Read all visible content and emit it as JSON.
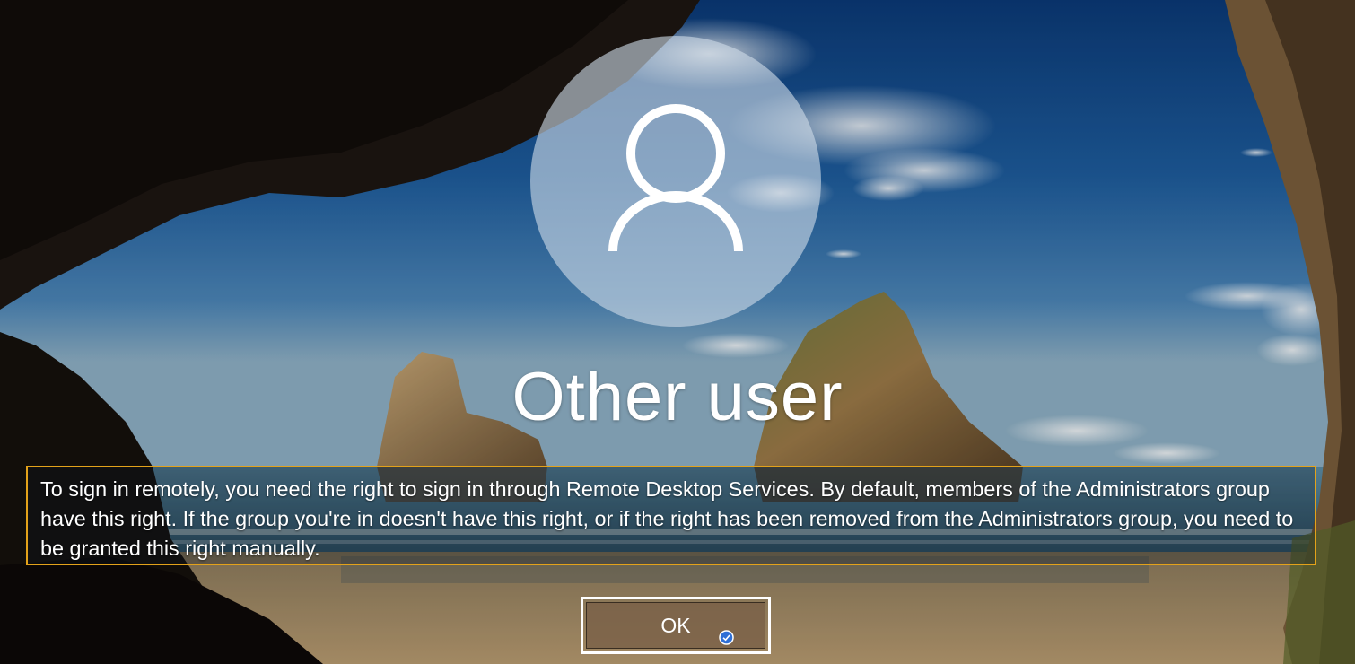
{
  "login": {
    "user_name": "Other user",
    "message": "To sign in remotely, you need the right to sign in through Remote Desktop Services. By default, members of the Administrators group have this right. If the group you're in doesn't have this right, or if the right has been removed from the Administrators group, you need to be granted this right manually.",
    "ok_label": "OK"
  },
  "icons": {
    "avatar": "user-silhouette-icon",
    "cursor": "touch-cursor-icon"
  },
  "colors": {
    "highlight_border": "#e3a21a",
    "button_border": "#ffffff",
    "text": "#ffffff"
  }
}
